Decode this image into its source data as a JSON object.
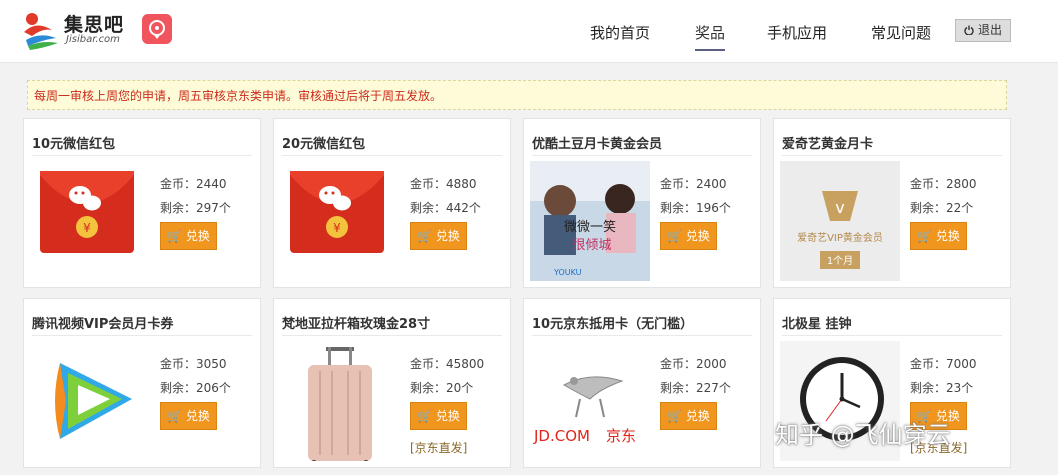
{
  "header": {
    "logo_text": "集思吧",
    "logo_sub": "Jisibar.com",
    "nav": [
      "我的首页",
      "奖品",
      "手机应用",
      "常见问题"
    ],
    "logout": "退出"
  },
  "notice": "每周一审核上周您的申请，周五审核京东类申请。审核通过后将于周五发放。",
  "labels": {
    "coins": "金币：",
    "remain": "剩余：",
    "unit": "个",
    "exchange": "兑换"
  },
  "products": [
    {
      "title": "10元微信红包",
      "coins": "2440",
      "remain": "297",
      "tag": ""
    },
    {
      "title": "20元微信红包",
      "coins": "4880",
      "remain": "442",
      "tag": ""
    },
    {
      "title": "优酷土豆月卡黄金会员",
      "coins": "2400",
      "remain": "196",
      "tag": ""
    },
    {
      "title": "爱奇艺黄金月卡",
      "coins": "2800",
      "remain": "22",
      "tag": ""
    },
    {
      "title": "腾讯视频VIP会员月卡券",
      "coins": "3050",
      "remain": "206",
      "tag": ""
    },
    {
      "title": "梵地亚拉杆箱玫瑰金28寸",
      "coins": "45800",
      "remain": "20",
      "tag": "[京东直发]"
    },
    {
      "title": "10元京东抵用卡（无门槛）",
      "coins": "2000",
      "remain": "227",
      "tag": ""
    },
    {
      "title": "北极星 挂钟",
      "coins": "7000",
      "remain": "23",
      "tag": "[京东直发]"
    }
  ],
  "images": {
    "youku_text1": "微微一笑",
    "youku_text2": "很倾城",
    "youku_brand": "YOUKU",
    "iqiyi_brand": "爱奇艺VIP黄金会员",
    "iqiyi_month": "1个月",
    "jd_brand": "JD.COM",
    "jd_cn": "京东"
  },
  "watermark": "知乎 @飞仙穿云",
  "colors": {
    "button": "#f0961e",
    "notice_text": "#cc2b1d",
    "notice_bg": "#fefcd8",
    "nav_underline": "#5b5f86"
  }
}
